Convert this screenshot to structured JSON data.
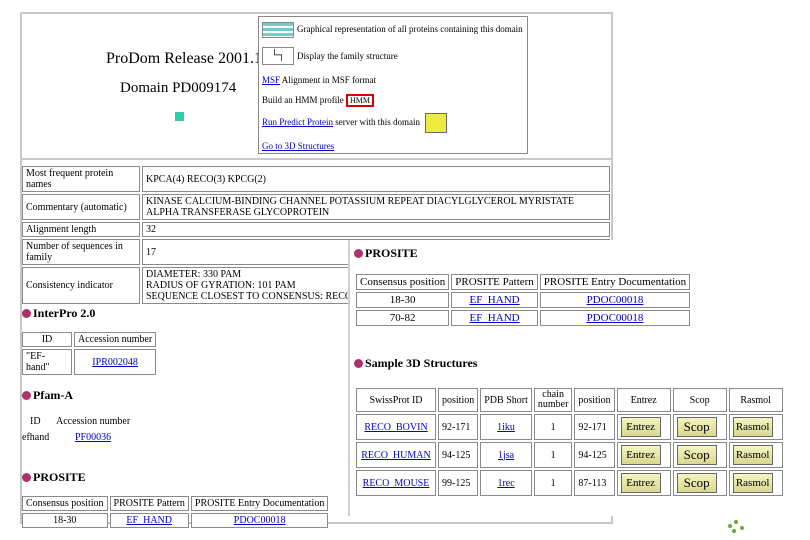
{
  "top": {
    "release": "ProDom Release 2001.1",
    "domain": "Domain PD009174",
    "links": [
      {
        "text": "Graphical representation of all proteins containing this domain"
      },
      {
        "text": "Display the family structure"
      },
      {
        "link": "MSF",
        "text": " Alignment in MSF format"
      },
      {
        "text": "Build an HMM profile",
        "box": "HMM"
      },
      {
        "link": "Run Predict Protein",
        "text": " server with this domain"
      },
      {
        "link": "Go to 3D Structures",
        "text": ""
      }
    ]
  },
  "info": {
    "rows": [
      {
        "label": "Most frequent protein names",
        "value": "KPCA(4) RECO(3) KPCG(2)"
      },
      {
        "label": "Commentary (automatic)",
        "value": "KINASE CALCIUM-BINDING CHANNEL POTASSIUM REPEAT DIACYLGLYCEROL MYRISTATE ALPHA TRANSFERASE GLYCOPROTEIN"
      },
      {
        "label": "Alignment length",
        "value": "32"
      },
      {
        "label": "Number of sequences in family",
        "value": "17"
      },
      {
        "label": "Consistency indicator",
        "value": "DIAMETER: 330 PAM\nRADIUS OF GYRATION: 101 PAM\nSEQUENCE CLOSEST TO CONSENSUS: RECO"
      }
    ]
  },
  "interpro": {
    "title": "InterPro 2.0",
    "headers": [
      "ID",
      "Accession number"
    ],
    "row": [
      "\"EF-hand\"",
      "IPR002048"
    ]
  },
  "pfam": {
    "title": "Pfam-A",
    "headers": [
      "ID",
      "Accession number"
    ],
    "row": [
      "efhand",
      "PF00036"
    ]
  },
  "prosite_small": {
    "title": "PROSITE",
    "headers": [
      "Consensus position",
      "PROSITE Pattern",
      "PROSITE Entry Documentation"
    ],
    "row": [
      "18-30",
      "EF_HAND",
      "PDOC00018"
    ]
  },
  "prosite": {
    "title": "PROSITE",
    "headers": [
      "Consensus position",
      "PROSITE Pattern",
      "PROSITE Entry Documentation"
    ],
    "rows": [
      [
        "18-30",
        "EF_HAND",
        "PDOC00018"
      ],
      [
        "70-82",
        "EF_HAND",
        "PDOC00018"
      ]
    ]
  },
  "structures": {
    "title": "Sample 3D Structures",
    "headers": [
      "SwissProt ID",
      "position",
      "PDB Short",
      "chain number",
      "position",
      "Entrez",
      "Scop",
      "Rasmol"
    ],
    "rows": [
      [
        "RECO_BOVIN",
        "92-171",
        "1iku",
        "1",
        "92-171"
      ],
      [
        "RECO_HUMAN",
        "94-125",
        "1jsa",
        "1",
        "94-125"
      ],
      [
        "RECO_MOUSE",
        "99-125",
        "1rec",
        "1",
        "87-113"
      ]
    ],
    "buttons": [
      "Entrez",
      "Scop",
      "Rasmol"
    ]
  },
  "colors": {
    "bullet": "#b0306a",
    "link": "#0000cc",
    "marker": "#33ccaa"
  }
}
